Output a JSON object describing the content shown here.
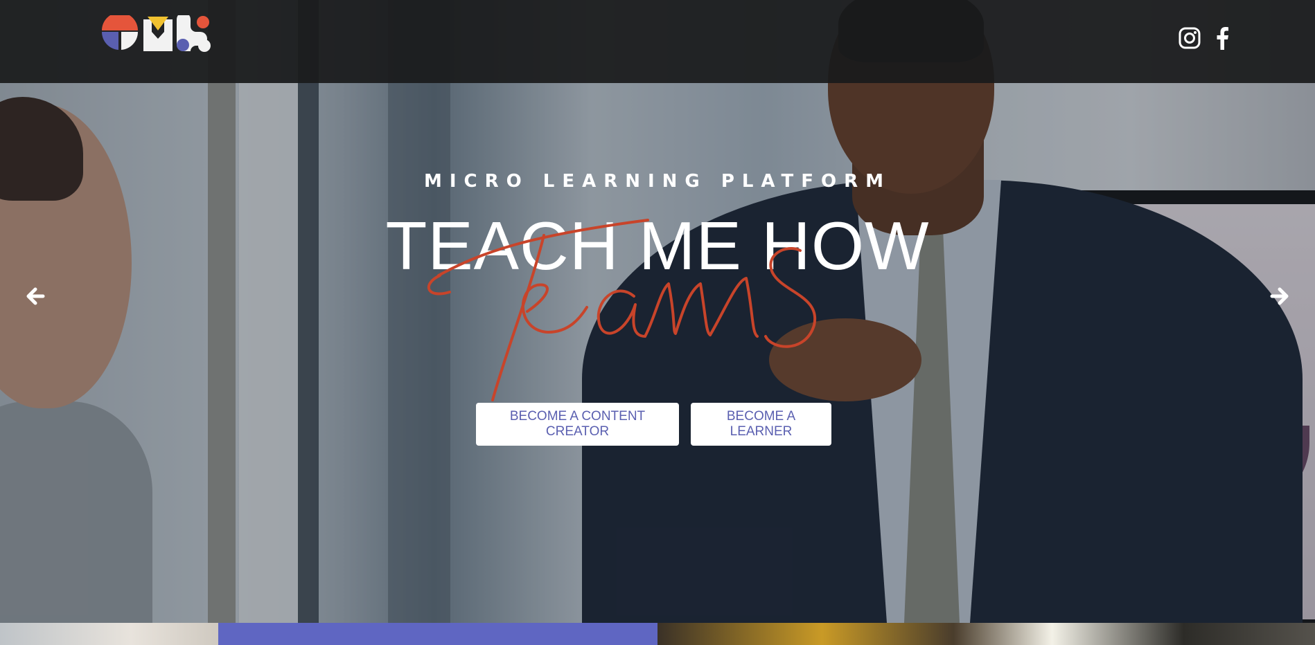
{
  "brand": {
    "logo_text": "TMH",
    "colors": {
      "red": "#e5553b",
      "yellow": "#f2c230",
      "blue": "#5a5fb0",
      "white": "#f2f2f2"
    }
  },
  "header": {
    "social": [
      {
        "icon": "instagram-icon"
      },
      {
        "icon": "facebook-icon"
      }
    ]
  },
  "hero": {
    "eyebrow": "MICRO LEARNING PLATFORM",
    "headline": "TEACH ME HOW",
    "script_word": "Teams",
    "buttons": {
      "creator_label": "BECOME A CONTENT CREATOR",
      "learner_label": "BECOME A LEARNER"
    },
    "accent_color": "#c8442a"
  },
  "carousel": {
    "prev_icon": "arrow-left-icon",
    "next_icon": "arrow-right-icon"
  }
}
